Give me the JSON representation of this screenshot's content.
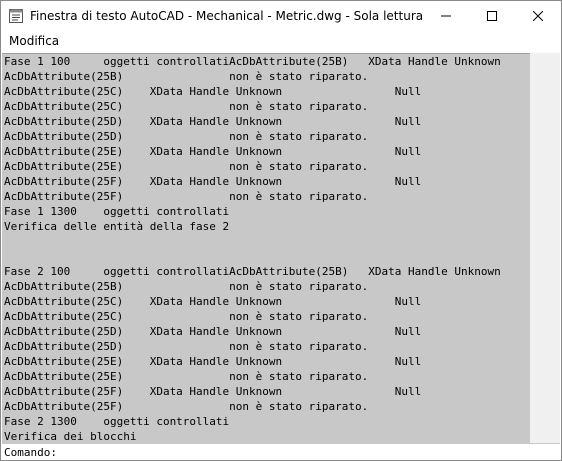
{
  "window": {
    "title": "Finestra di testo AutoCAD - Mechanical - Metric.dwg - Sola lettura",
    "app_icon": "autocad-text-window-icon",
    "controls": [
      "minimize-icon",
      "maximize-icon",
      "close-icon"
    ]
  },
  "menubar": {
    "items": [
      "Modifica"
    ]
  },
  "text_window": {
    "background": "#c8c8c8",
    "lines": [
      "Fase 1 100     oggetti controllatiAcDbAttribute(25B)   XData Handle Unknown",
      "AcDbAttribute(25B)                non è stato riparato.",
      "AcDbAttribute(25C)    XData Handle Unknown                 Null",
      "AcDbAttribute(25C)                non è stato riparato.",
      "AcDbAttribute(25D)    XData Handle Unknown                 Null",
      "AcDbAttribute(25D)                non è stato riparato.",
      "AcDbAttribute(25E)    XData Handle Unknown                 Null",
      "AcDbAttribute(25E)                non è stato riparato.",
      "AcDbAttribute(25F)    XData Handle Unknown                 Null",
      "AcDbAttribute(25F)                non è stato riparato.",
      "Fase 1 1300    oggetti controllati",
      "Verifica delle entità della fase 2",
      "",
      "",
      "Fase 2 100     oggetti controllatiAcDbAttribute(25B)   XData Handle Unknown",
      "AcDbAttribute(25B)                non è stato riparato.",
      "AcDbAttribute(25C)    XData Handle Unknown                 Null",
      "AcDbAttribute(25C)                non è stato riparato.",
      "AcDbAttribute(25D)    XData Handle Unknown                 Null",
      "AcDbAttribute(25D)                non è stato riparato.",
      "AcDbAttribute(25E)    XData Handle Unknown                 Null",
      "AcDbAttribute(25E)                non è stato riparato.",
      "AcDbAttribute(25F)    XData Handle Unknown                 Null",
      "AcDbAttribute(25F)                non è stato riparato.",
      "Fase 2 1300    oggetti controllati",
      "Verifica dei blocchi"
    ]
  },
  "command": {
    "label": "Comando:",
    "value": ""
  }
}
